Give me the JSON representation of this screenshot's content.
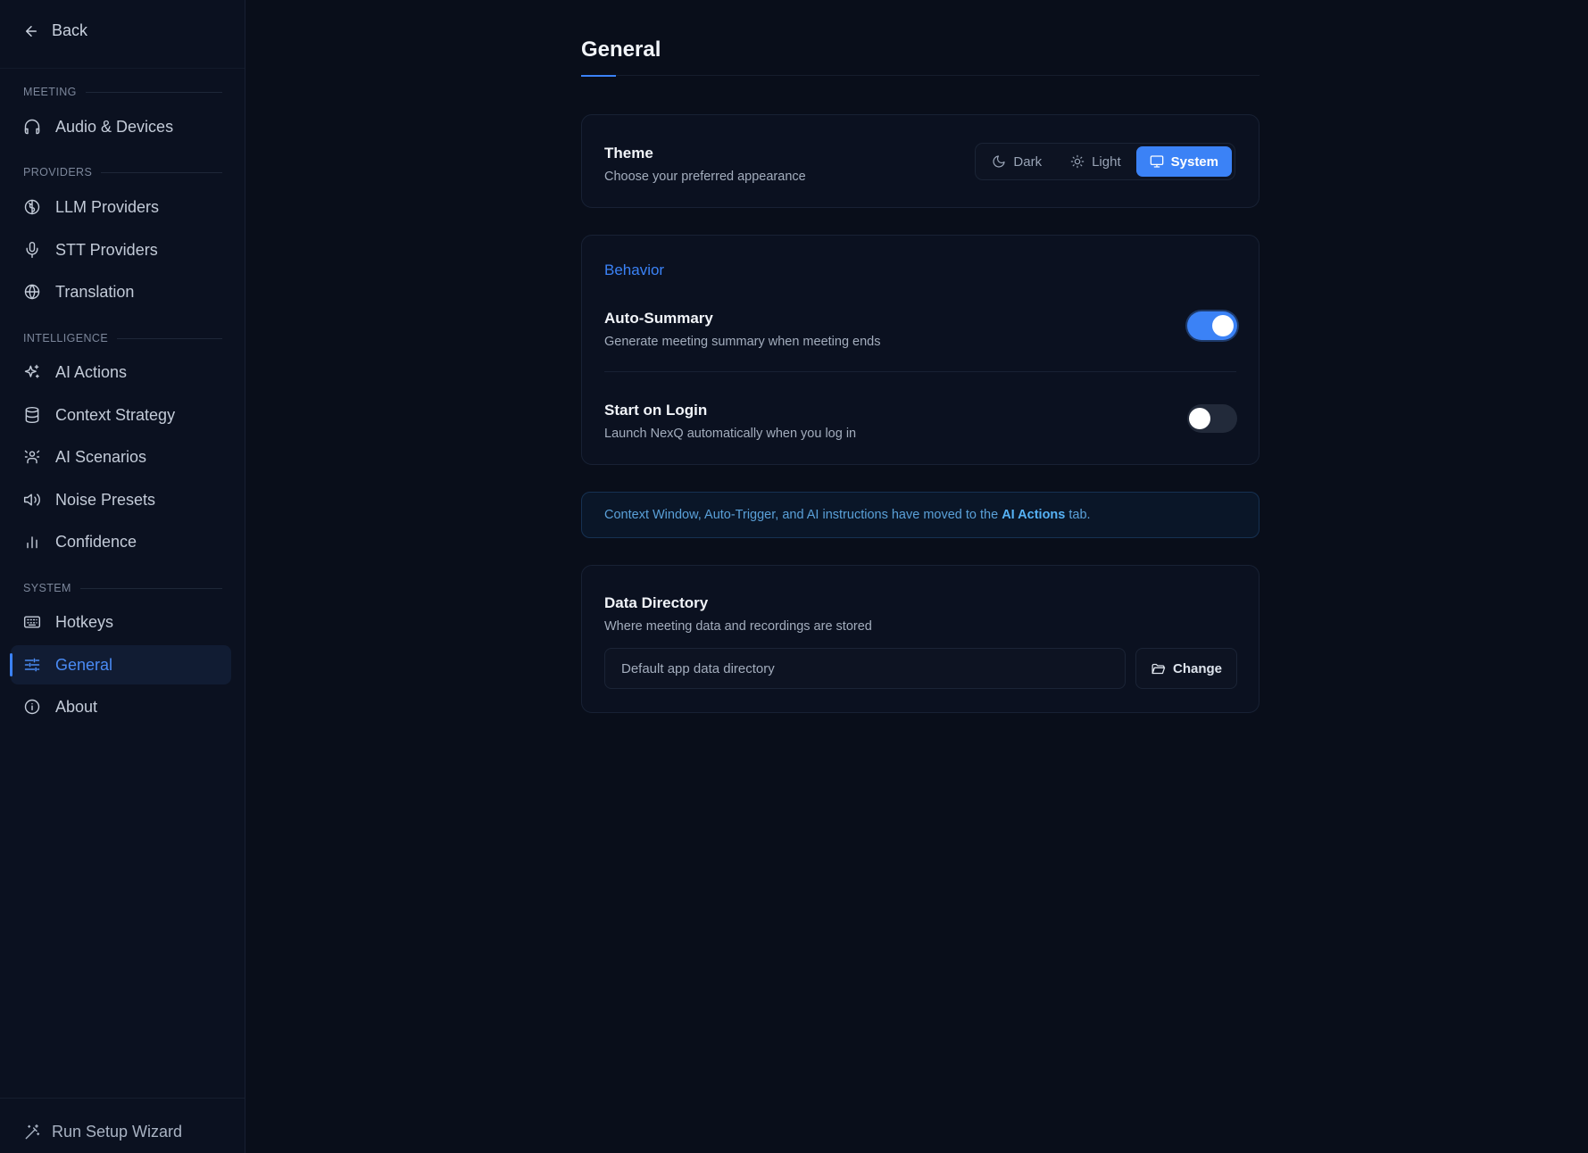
{
  "sidebar": {
    "back_label": "Back",
    "sections": [
      {
        "label": "MEETING"
      },
      {
        "label": "PROVIDERS"
      },
      {
        "label": "INTELLIGENCE"
      },
      {
        "label": "SYSTEM"
      }
    ],
    "items": [
      {
        "label": "Audio & Devices",
        "icon": "headphones-icon"
      },
      {
        "label": "LLM Providers",
        "icon": "brain-icon"
      },
      {
        "label": "STT Providers",
        "icon": "microphone-icon"
      },
      {
        "label": "Translation",
        "icon": "globe-icon"
      },
      {
        "label": "AI Actions",
        "icon": "sparkles-icon"
      },
      {
        "label": "Context Strategy",
        "icon": "database-icon"
      },
      {
        "label": "AI Scenarios",
        "icon": "scenarios-icon"
      },
      {
        "label": "Noise Presets",
        "icon": "speaker-icon"
      },
      {
        "label": "Confidence",
        "icon": "bar-chart-icon"
      },
      {
        "label": "Hotkeys",
        "icon": "keyboard-icon"
      },
      {
        "label": "General",
        "icon": "sliders-icon",
        "active": true
      },
      {
        "label": "About",
        "icon": "info-icon"
      }
    ],
    "wizard_label": "Run Setup Wizard"
  },
  "main": {
    "title": "General",
    "theme": {
      "title": "Theme",
      "description": "Choose your preferred appearance",
      "options": [
        "Dark",
        "Light",
        "System"
      ],
      "selected": "System"
    },
    "behavior": {
      "heading": "Behavior",
      "auto_summary": {
        "title": "Auto-Summary",
        "description": "Generate meeting summary when meeting ends",
        "enabled": true
      },
      "start_on_login": {
        "title": "Start on Login",
        "description": "Launch NexQ automatically when you log in",
        "enabled": false
      }
    },
    "notice": {
      "text_before": "Context Window, Auto-Trigger, and AI instructions have moved to the ",
      "link": "AI Actions",
      "text_after": " tab."
    },
    "data_directory": {
      "title": "Data Directory",
      "description": "Where meeting data and recordings are stored",
      "value": "Default app data directory",
      "change_label": "Change"
    }
  },
  "colors": {
    "accent": "#3b82f6",
    "background": "#090e1a",
    "sidebar": "#0b1120",
    "notice_text": "#5aa0d8"
  }
}
